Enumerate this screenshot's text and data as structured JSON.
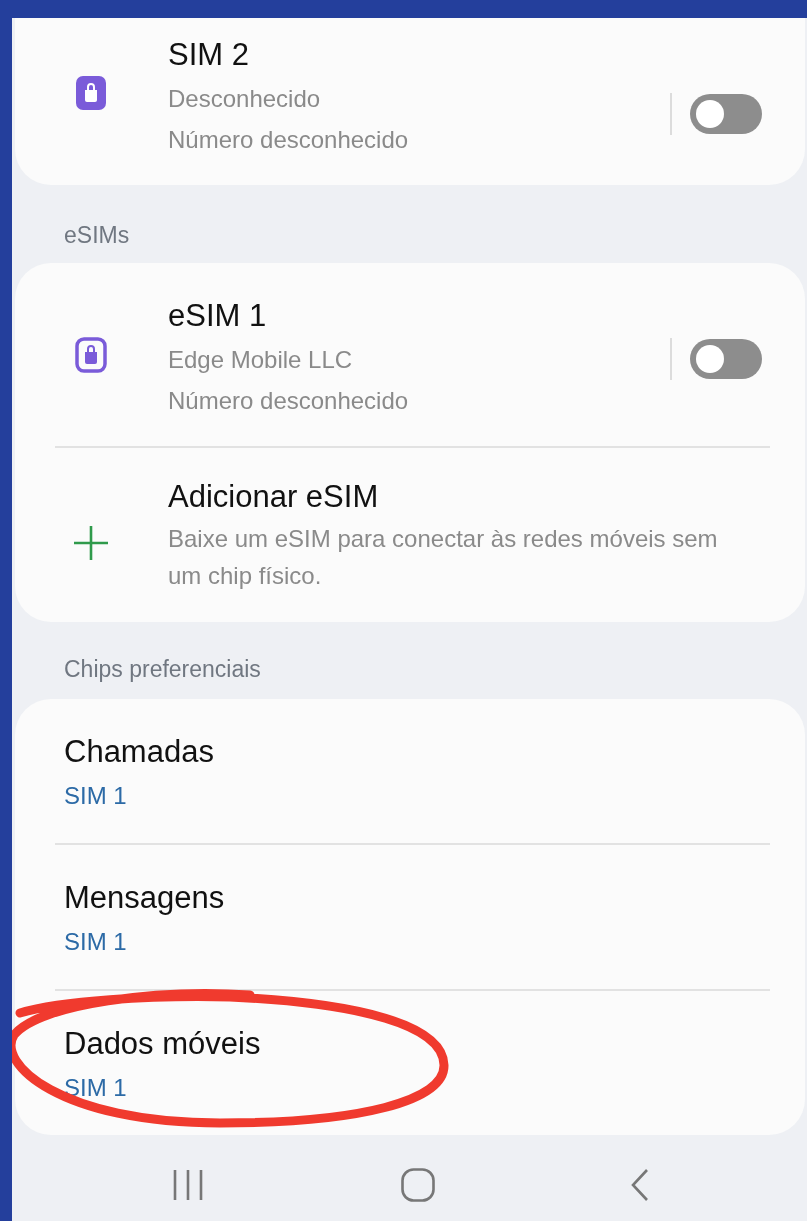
{
  "sim_cards": {
    "items": [
      {
        "kind": "sim",
        "title": "SIM 2",
        "carrier": "Desconhecido",
        "number": "Número desconhecido",
        "on": false
      }
    ]
  },
  "esims": {
    "header": "eSIMs",
    "items": [
      {
        "kind": "esim",
        "title": "eSIM 1",
        "carrier": "Edge Mobile LLC",
        "number": "Número desconhecido",
        "on": false
      },
      {
        "kind": "add",
        "title": "Adicionar eSIM",
        "description": "Baixe um eSIM para conectar às redes móveis sem um chip físico."
      }
    ]
  },
  "preferred": {
    "header": "Chips preferenciais",
    "items": [
      {
        "label": "Chamadas",
        "value": "SIM 1"
      },
      {
        "label": "Mensagens",
        "value": "SIM 1"
      },
      {
        "label": "Dados móveis",
        "value": "SIM 1"
      }
    ]
  }
}
